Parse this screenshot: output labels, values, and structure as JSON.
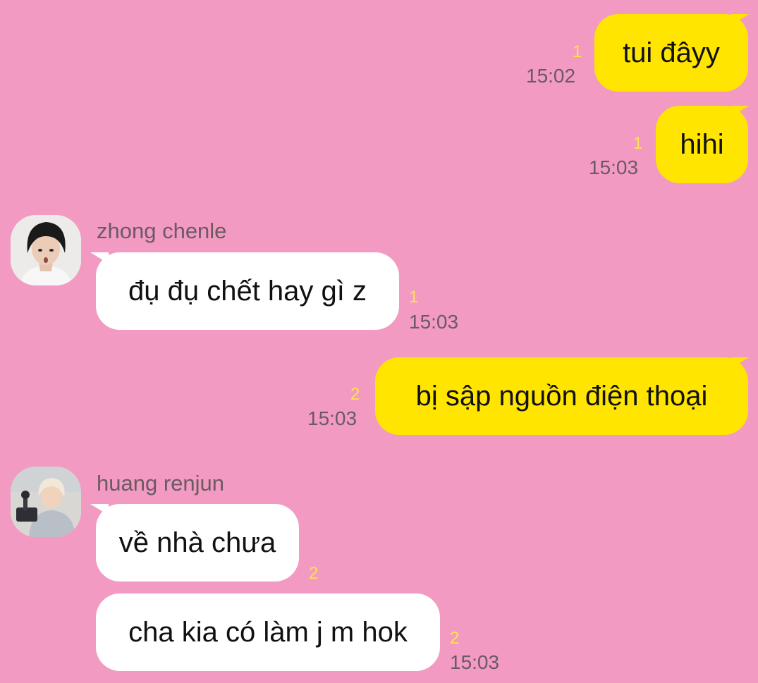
{
  "chat": {
    "messages": [
      {
        "from": "me",
        "text": "tui đâyy",
        "unread": "1",
        "time": "15:02"
      },
      {
        "from": "me",
        "text": "hihi",
        "unread": "1",
        "time": "15:03"
      },
      {
        "from": "them",
        "sender": "zhong chenle",
        "avatar": "avatar-chenle",
        "text": "đụ đụ chết hay gì z",
        "unread": "1",
        "time": "15:03"
      },
      {
        "from": "me",
        "text": "bị sập nguồn điện thoại",
        "unread": "2",
        "time": "15:03"
      },
      {
        "from": "them",
        "sender": "huang renjun",
        "avatar": "avatar-renjun",
        "text": "về nhà chưa",
        "unread": "2",
        "time": ""
      },
      {
        "from": "them",
        "text": "cha kia có làm j m hok",
        "unread": "2",
        "time": "15:03"
      }
    ]
  },
  "colors": {
    "background": "#f29ac2",
    "my_bubble": "#ffe500",
    "their_bubble": "#ffffff",
    "unread": "#ffe24a",
    "meta_text": "#6a5a62"
  }
}
